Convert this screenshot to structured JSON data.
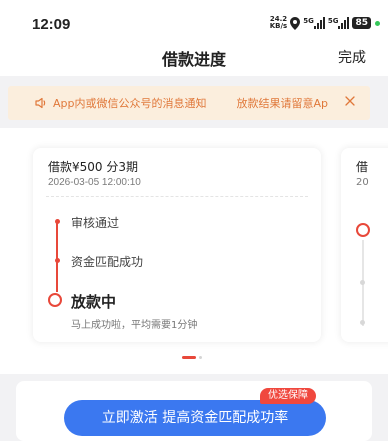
{
  "status_bar": {
    "time": "12:09",
    "net_speed_value": "24.2",
    "net_speed_unit": "KB/s",
    "sig1_label": "5G",
    "sig2_label": "5G",
    "battery": "85"
  },
  "header": {
    "title": "借款进度",
    "done_label": "完成"
  },
  "notice": {
    "text": "App内或微信公众号的消息通知",
    "text2": "放款结果请留意Ap"
  },
  "loan_card": {
    "title": "借款¥500  分3期",
    "date": "2026-03-05 12:00:10",
    "steps": [
      {
        "label": "审核通过"
      },
      {
        "label": "资金匹配成功"
      }
    ],
    "current_step": "放款中",
    "current_sub": "马上成功啦，平均需要1分钟"
  },
  "peek_card": {
    "title": "借",
    "date": "20"
  },
  "cta": {
    "label": "立即激活 提高资金匹配成功率",
    "badge": "优选保障"
  },
  "colors": {
    "accent_red": "#e8483a",
    "button_blue": "#3b78f0",
    "notice_orange": "#e0783a"
  }
}
